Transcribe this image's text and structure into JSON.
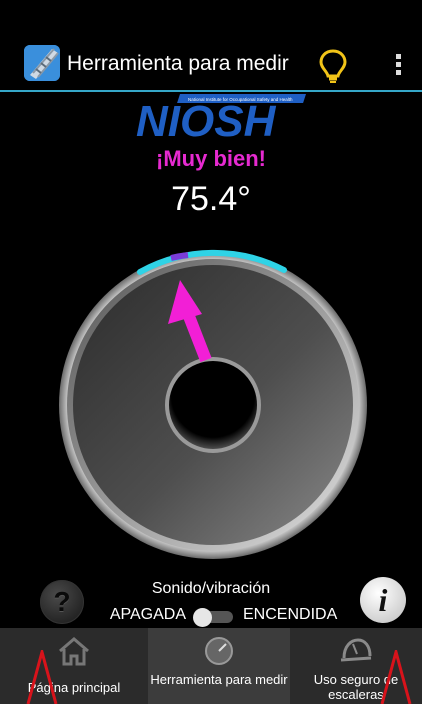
{
  "app": {
    "title": "Herramienta para medir",
    "icons": {
      "app": "ladder-app-icon",
      "tip": "lightbulb-icon",
      "menu": "overflow-menu-icon"
    },
    "accent": "#35a7c9"
  },
  "logo": {
    "text": "NIOSH",
    "subtitle": "National Institute for Occupational Safety and Health",
    "color": "#1f5fc4"
  },
  "status_message": "¡Muy bien!",
  "status_color": "#e62ad0",
  "angle_reading": "75.4°",
  "controls": {
    "sound_label": "Sonido/vibración",
    "off_label": "APAGADA",
    "on_label": "ENCENDIDA",
    "help_glyph": "?",
    "info_glyph": "i"
  },
  "tabs": [
    {
      "label": "Página principal",
      "icon": "home-icon"
    },
    {
      "label": "Herramienta para medir",
      "icon": "gauge-icon"
    },
    {
      "label": "Uso seguro de escaleras",
      "icon": "hard-hat-icon"
    }
  ]
}
